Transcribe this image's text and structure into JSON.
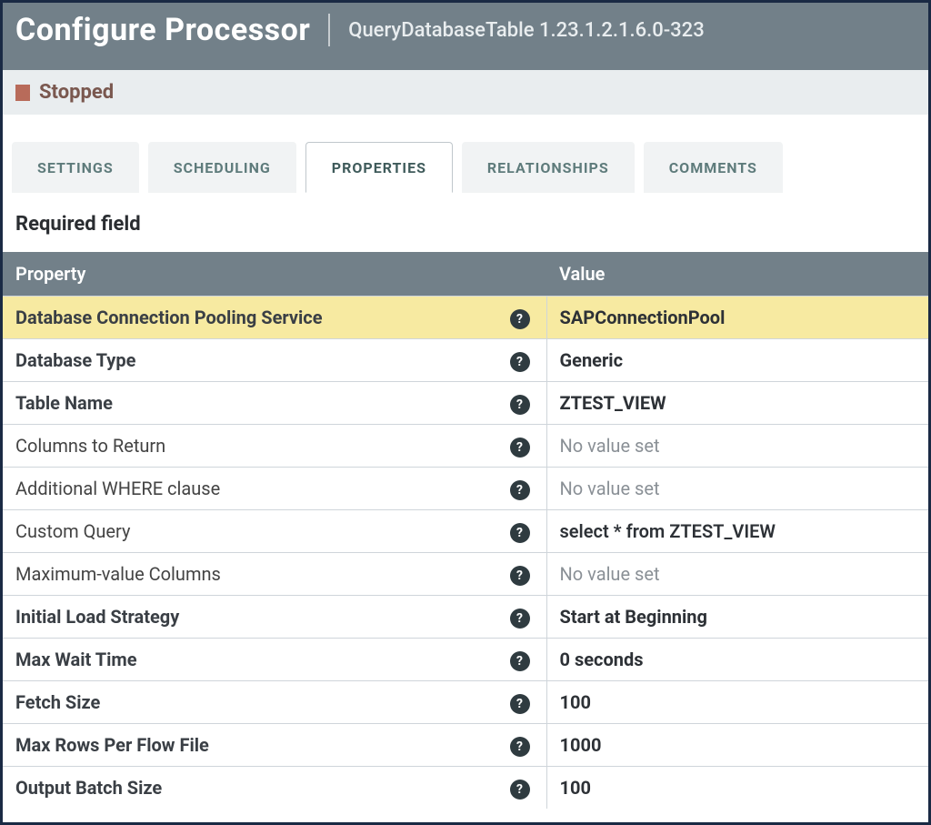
{
  "header": {
    "title": "Configure Processor",
    "subtitle": "QueryDatabaseTable 1.23.1.2.1.6.0-323"
  },
  "status": {
    "label": "Stopped"
  },
  "tabs": [
    {
      "label": "SETTINGS",
      "active": false
    },
    {
      "label": "SCHEDULING",
      "active": false
    },
    {
      "label": "PROPERTIES",
      "active": true
    },
    {
      "label": "RELATIONSHIPS",
      "active": false
    },
    {
      "label": "COMMENTS",
      "active": false
    }
  ],
  "required_label": "Required field",
  "table": {
    "headers": {
      "property": "Property",
      "value": "Value"
    },
    "rows": [
      {
        "name": "Database Connection Pooling Service",
        "required": true,
        "value": "SAPConnectionPool",
        "novalue": false,
        "highlight": true
      },
      {
        "name": "Database Type",
        "required": true,
        "value": "Generic",
        "novalue": false,
        "highlight": false
      },
      {
        "name": "Table Name",
        "required": true,
        "value": "ZTEST_VIEW",
        "novalue": false,
        "highlight": false
      },
      {
        "name": "Columns to Return",
        "required": false,
        "value": "No value set",
        "novalue": true,
        "highlight": false
      },
      {
        "name": "Additional WHERE clause",
        "required": false,
        "value": "No value set",
        "novalue": true,
        "highlight": false
      },
      {
        "name": "Custom Query",
        "required": false,
        "value": "select * from ZTEST_VIEW",
        "novalue": false,
        "highlight": false
      },
      {
        "name": "Maximum-value Columns",
        "required": false,
        "value": "No value set",
        "novalue": true,
        "highlight": false
      },
      {
        "name": "Initial Load Strategy",
        "required": true,
        "value": "Start at Beginning",
        "novalue": false,
        "highlight": false
      },
      {
        "name": "Max Wait Time",
        "required": true,
        "value": "0 seconds",
        "novalue": false,
        "highlight": false
      },
      {
        "name": "Fetch Size",
        "required": true,
        "value": "100",
        "novalue": false,
        "highlight": false
      },
      {
        "name": "Max Rows Per Flow File",
        "required": true,
        "value": "1000",
        "novalue": false,
        "highlight": false
      },
      {
        "name": "Output Batch Size",
        "required": true,
        "value": "100",
        "novalue": false,
        "highlight": false
      }
    ]
  }
}
